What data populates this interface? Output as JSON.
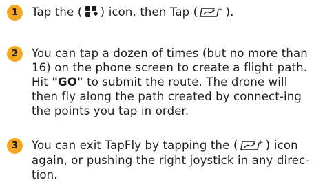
{
  "steps": [
    {
      "number": "1",
      "text_a": "Tap the",
      "icon_a": "apps-grid-icon",
      "text_b": "icon, then Tap",
      "icon_b": "tapfly-icon",
      "text_c": "."
    },
    {
      "number": "2",
      "text_before_go": "You can tap a dozen of times (but no more than 16) on the phone screen to create a flight path. Hit ",
      "go_label": "\"GO\"",
      "text_after_go": " to submit the route. The drone will then fly along the path created by connect-ing the points you tap in order."
    },
    {
      "number": "3",
      "text_a": "You can exit TapFly by tapping the",
      "icon": "tapfly-icon",
      "text_b": "icon again, or pushing the right joystick in any direc-tion."
    }
  ],
  "colors": {
    "badge": "#f5a623",
    "text": "#1e1e1e",
    "background": "#ffffff"
  }
}
